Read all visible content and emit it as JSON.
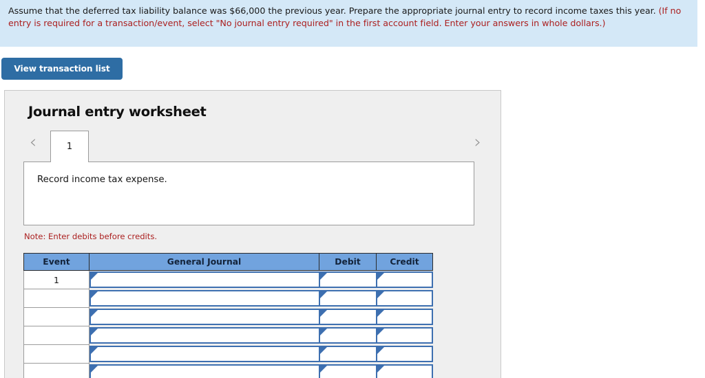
{
  "banner": {
    "black_part_1": "Assume that the deferred tax liability balance was $66,000 the previous year. Prepare the appropriate journal entry to record income taxes this year. ",
    "red_part": "(If no entry is required for a transaction/event, select \"No journal entry required\" in the first account field. Enter your answers in whole dollars.)",
    "background_color": "#d4e8f7",
    "red_color": "#ab2020"
  },
  "toolbar": {
    "view_transaction_list_label": "View transaction list",
    "button_color": "#2e6da4"
  },
  "worksheet": {
    "title": "Journal entry worksheet",
    "prev_icon": "chevron-left-icon",
    "next_icon": "chevron-right-icon",
    "prev_glyph": "‹",
    "next_glyph": "›",
    "tabs": [
      {
        "label": "1",
        "active": true
      }
    ],
    "prompt": "Record income tax expense.",
    "note": "Note: Enter debits before credits.",
    "note_color": "#ab2020"
  },
  "table": {
    "header_color": "#71a3de",
    "input_border_color": "#3d6fb0",
    "columns": [
      "Event",
      "General Journal",
      "Debit",
      "Credit"
    ],
    "rows": [
      {
        "event": "1",
        "general_journal": "",
        "debit": "",
        "credit": ""
      },
      {
        "event": "",
        "general_journal": "",
        "debit": "",
        "credit": ""
      },
      {
        "event": "",
        "general_journal": "",
        "debit": "",
        "credit": ""
      },
      {
        "event": "",
        "general_journal": "",
        "debit": "",
        "credit": ""
      },
      {
        "event": "",
        "general_journal": "",
        "debit": "",
        "credit": ""
      },
      {
        "event": "",
        "general_journal": "",
        "debit": "",
        "credit": ""
      }
    ]
  }
}
